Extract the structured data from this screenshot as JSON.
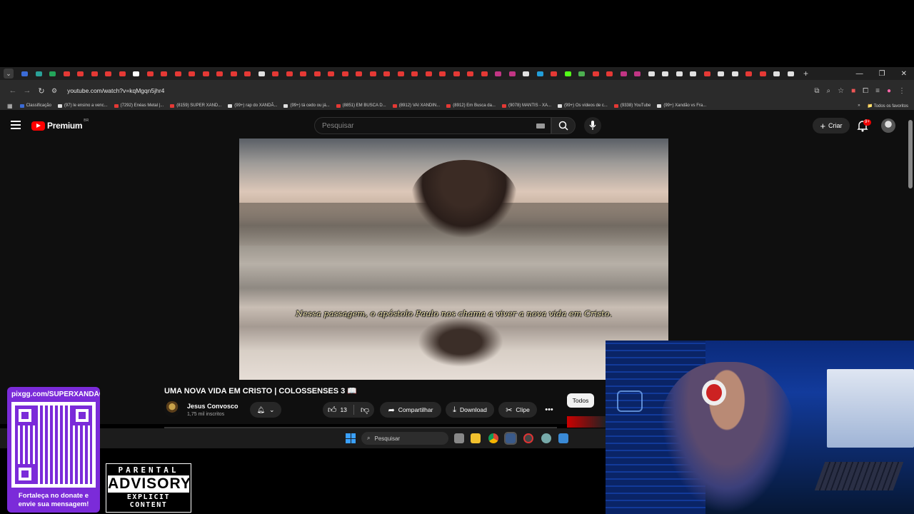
{
  "browser": {
    "tab_colors": [
      "#3b6bd6",
      "#2aa198",
      "#23a55a",
      "#e53935",
      "#e53935",
      "#e53935",
      "#e53935",
      "#e53935",
      "#ffffff",
      "#e53935",
      "#e53935",
      "#e53935",
      "#e53935",
      "#e53935",
      "#e53935",
      "#e53935",
      "#e53935",
      "#e0e0e0",
      "#e53935",
      "#e53935",
      "#e53935",
      "#e53935",
      "#e53935",
      "#e53935",
      "#e53935",
      "#e53935",
      "#e53935",
      "#e53935",
      "#e53935",
      "#e53935",
      "#e53935",
      "#e53935",
      "#e53935",
      "#e53935",
      "#c13584",
      "#c13584",
      "#e0e0e0",
      "#229ed9",
      "#e53935",
      "#53fc18",
      "#4caf50",
      "#e53935",
      "#e53935",
      "#c13584",
      "#c13584",
      "#e0e0e0",
      "#e0e0e0",
      "#e0e0e0",
      "#e0e0e0",
      "#e53935",
      "#e0e0e0",
      "#e0e0e0",
      "#e53935",
      "#e53935",
      "#e0e0e0",
      "#e0e0e0"
    ],
    "url": "youtube.com/watch?v=kqMgqn5jhr4",
    "bookmarks": [
      {
        "label": "Classificação",
        "color": "#3b6bd6"
      },
      {
        "label": "(97) le ensino a venc...",
        "color": "#e0e0e0"
      },
      {
        "label": "(7292) Enéas Metal |...",
        "color": "#e53935"
      },
      {
        "label": "(8159) SUPER XAND...",
        "color": "#e53935"
      },
      {
        "label": "(99+) rap do XANDÃ...",
        "color": "#e0e0e0"
      },
      {
        "label": "(99+) tá cedo ou já...",
        "color": "#e0e0e0"
      },
      {
        "label": "(8851) EM BUSCA D...",
        "color": "#e53935"
      },
      {
        "label": "(8912) VAI XANDIN...",
        "color": "#e53935"
      },
      {
        "label": "(8912) Em Busca da...",
        "color": "#e53935"
      },
      {
        "label": "(9078) MANTIS - XA...",
        "color": "#e53935"
      },
      {
        "label": "(99+) Os vídeos de c...",
        "color": "#e0e0e0"
      },
      {
        "label": "(9338) YouTube",
        "color": "#e53935"
      },
      {
        "label": "(99+) Xandão vs Fra...",
        "color": "#e0e0e0"
      }
    ],
    "all_bookmarks": "Todos os favoritos"
  },
  "youtube": {
    "logo_text": "Premium",
    "logo_region": "BR",
    "search_placeholder": "Pesquisar",
    "create_label": "Criar",
    "notif_count": "9+",
    "subtitle": "Nessa passagem, o apóstolo Paulo nos chama a viver a nova vida em Cristo.",
    "video_title": "UMA NOVA VIDA EM CRISTO | COLOSSENSES 3 📖",
    "channel_name": "Jesus Convosco",
    "channel_subs": "1,75 mil inscritos",
    "like_count": "13",
    "share_label": "Compartilhar",
    "download_label": "Download",
    "clip_label": "Clipe",
    "chip_all": "Todos"
  },
  "taskbar": {
    "search_placeholder": "Pesquisar"
  },
  "overlay": {
    "donate_url": "pixgg.com/SUPERXANDÃO",
    "donate_msg": "Fortaleça no donate e envie sua mensagem!",
    "pa_top": "PARENTAL",
    "pa_mid": "ADVISORY",
    "pa_bot": "EXPLICIT CONTENT"
  },
  "colors": {
    "youtube_red": "#ff0000",
    "donate_purple": "#7b2bd9"
  }
}
